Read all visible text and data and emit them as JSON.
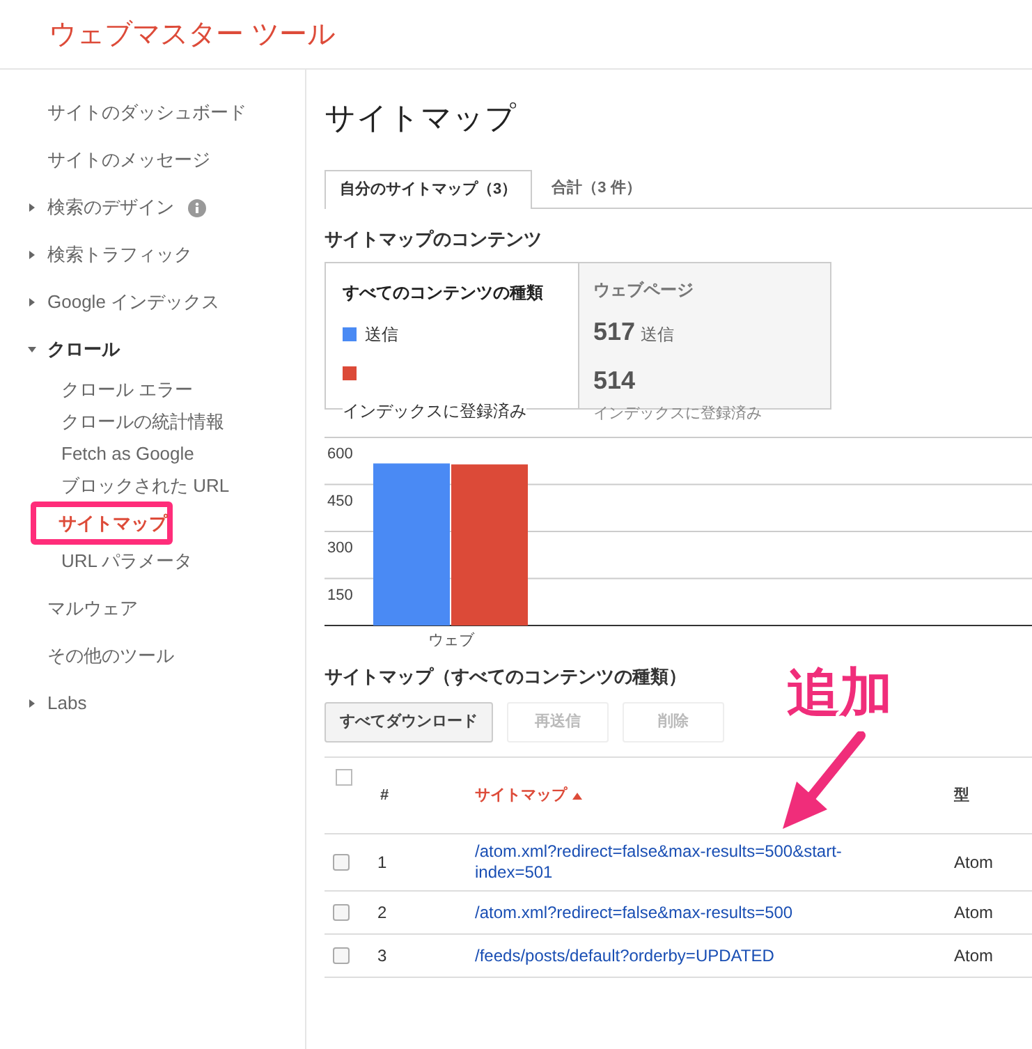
{
  "header": {
    "title": "ウェブマスター ツール"
  },
  "sidebar": {
    "items": [
      {
        "label": "サイトのダッシュボード",
        "kind": "link"
      },
      {
        "label": "サイトのメッセージ",
        "kind": "link"
      },
      {
        "label": "検索のデザイン",
        "kind": "section",
        "expanded": false,
        "info": true
      },
      {
        "label": "検索トラフィック",
        "kind": "section",
        "expanded": false
      },
      {
        "label": "Google インデックス",
        "kind": "section",
        "expanded": false
      },
      {
        "label": "クロール",
        "kind": "section",
        "expanded": true,
        "children": [
          {
            "label": "クロール エラー",
            "selected": false,
            "highlighted": false
          },
          {
            "label": "クロールの統計情報",
            "selected": false,
            "highlighted": false
          },
          {
            "label": "Fetch as Google",
            "selected": false,
            "highlighted": false
          },
          {
            "label": "ブロックされた URL",
            "selected": false,
            "highlighted": false
          },
          {
            "label": "サイトマップ",
            "selected": true,
            "highlighted": true
          },
          {
            "label": "URL パラメータ",
            "selected": false,
            "highlighted": false
          }
        ]
      },
      {
        "label": "マルウェア",
        "kind": "link"
      },
      {
        "label": "その他のツール",
        "kind": "link"
      },
      {
        "label": "Labs",
        "kind": "section",
        "expanded": false
      }
    ]
  },
  "page_title": "サイトマップ",
  "tabs": [
    {
      "label": "自分のサイトマップ（3）",
      "selected": true
    },
    {
      "label": "合計（3 件）",
      "selected": false
    }
  ],
  "contents": {
    "heading": "サイトマップのコンテンツ",
    "legend_title": "すべてのコンテンツの種類",
    "summary": {
      "title": "ウェブページ",
      "rows": [
        {
          "value": "517",
          "label": "送信"
        },
        {
          "value": "514",
          "label": "インデックスに登録済み"
        }
      ]
    },
    "chart_data": {
      "type": "bar",
      "categories": [
        "ウェブ"
      ],
      "series": [
        {
          "name": "送信",
          "color": "#4a8af4",
          "values": [
            517
          ]
        },
        {
          "name": "インデックスに登録済み",
          "color": "#dc4a38",
          "values": [
            514
          ]
        }
      ],
      "ylim": [
        0,
        600
      ],
      "yticks": [
        150,
        300,
        450,
        600
      ],
      "grid": true
    }
  },
  "sitemaps": {
    "heading": "サイトマップ（すべてのコンテンツの種類）",
    "buttons": [
      {
        "label": "すべてダウンロード",
        "disabled": false
      },
      {
        "label": "再送信",
        "disabled": true
      },
      {
        "label": "削除",
        "disabled": true
      }
    ],
    "select_all": {
      "checked": false
    },
    "columns": [
      {
        "label": "#",
        "sorted": false
      },
      {
        "label": "サイトマップ",
        "sorted": true
      },
      {
        "label": "型",
        "sorted": false
      }
    ],
    "rows": [
      {
        "number": "1",
        "path": "/atom.xml?redirect=false&max-results=500&start-index=501",
        "type": "Atom",
        "checked": false
      },
      {
        "number": "2",
        "path": "/atom.xml?redirect=false&max-results=500",
        "type": "Atom",
        "checked": false
      },
      {
        "number": "3",
        "path": "/feeds/posts/default?orderby=UPDATED",
        "type": "Atom",
        "checked": false
      }
    ]
  },
  "annotation": {
    "text": "追加"
  }
}
